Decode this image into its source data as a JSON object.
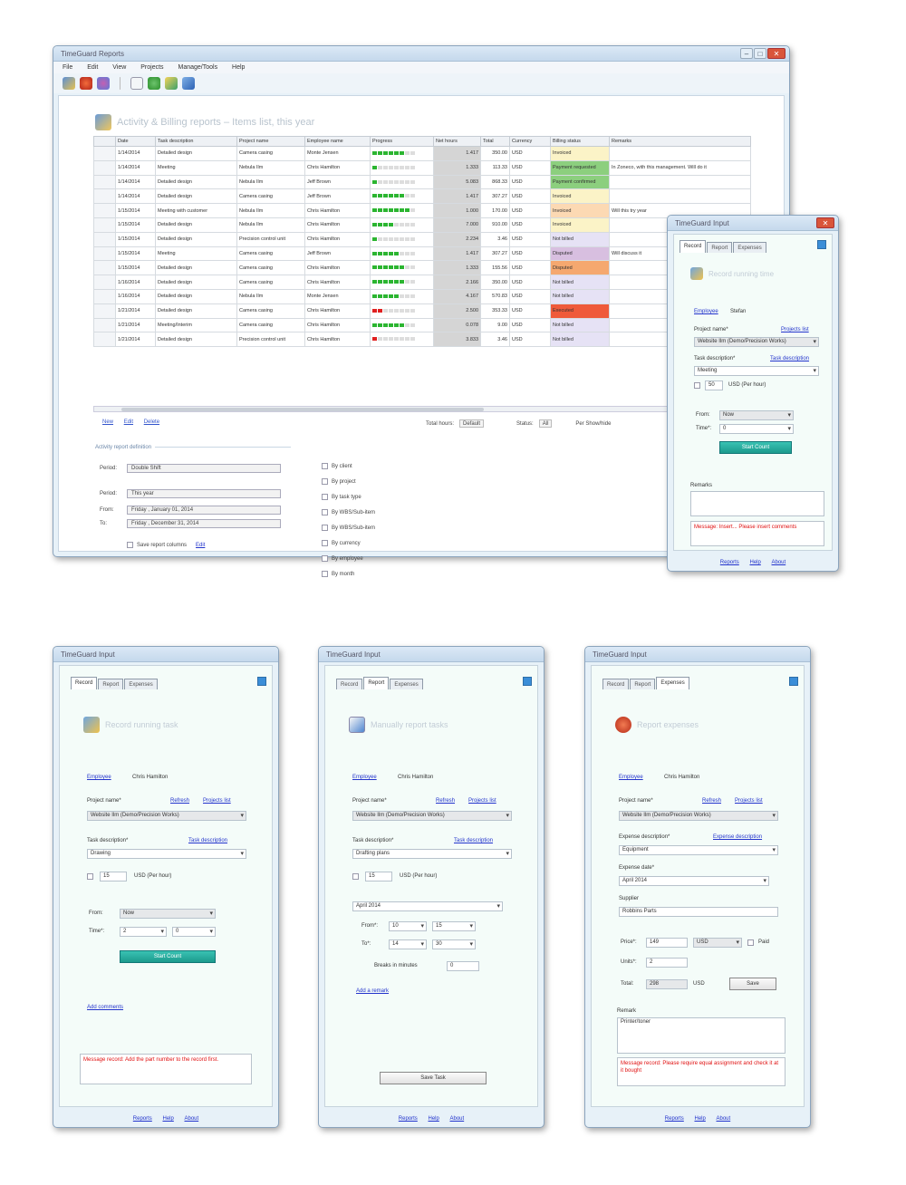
{
  "report_window": {
    "title": "TimeGuard Reports",
    "menu": [
      "File",
      "Edit",
      "View",
      "Projects",
      "Manage/Tools",
      "Help"
    ],
    "report_title": "Activity & Billing reports  –  Items list, this year",
    "columns": [
      "",
      "Date",
      "Task description",
      "Project name",
      "Employee name",
      "Progress",
      "Net hours",
      "Total",
      "Currency",
      "Billing status",
      "Remarks"
    ],
    "rows": [
      {
        "date": "1/14/2014",
        "task": "Detailed design",
        "project": "Camera casing",
        "employee": "Monte Jensen",
        "prog": 6,
        "hours": "1.417",
        "total": "350.00",
        "cur": "USD",
        "status": "Invoiced",
        "status_color": "#fbf3c7",
        "remarks": ""
      },
      {
        "date": "1/14/2014",
        "task": "Meeting",
        "project": "Nebula Ilm",
        "employee": "Chris Hamilton",
        "prog": 1,
        "hours": "1.333",
        "total": "113.33",
        "cur": "USD",
        "status": "Payment requested",
        "status_color": "#8ccf7e",
        "remarks": "In Zoneco, with this management. Will do it"
      },
      {
        "date": "1/14/2014",
        "task": "Detailed design",
        "project": "Nebula Ilm",
        "employee": "Jeff Brown",
        "prog": 1,
        "hours": "5.083",
        "total": "868.33",
        "cur": "USD",
        "status": "Payment confirmed",
        "status_color": "#8ccf7e",
        "remarks": ""
      },
      {
        "date": "1/14/2014",
        "task": "Detailed design",
        "project": "Camera casing",
        "employee": "Jeff Brown",
        "prog": 6,
        "hours": "1.417",
        "total": "307.27",
        "cur": "USD",
        "status": "Invoiced",
        "status_color": "#fbf3c7",
        "remarks": ""
      },
      {
        "date": "1/15/2014",
        "task": "Meeting with customer",
        "project": "Nebula Ilm",
        "employee": "Chris Hamilton",
        "prog": 7,
        "hours": "1.000",
        "total": "170.00",
        "cur": "USD",
        "status": "Invoiced",
        "status_color": "#fcd9b3",
        "remarks": "Will this try year"
      },
      {
        "date": "1/15/2014",
        "task": "Detailed design",
        "project": "Nebula Ilm",
        "employee": "Chris Hamilton",
        "prog": 4,
        "hours": "7.000",
        "total": "910.00",
        "cur": "USD",
        "status": "Invoiced",
        "status_color": "#fbf3c7",
        "remarks": ""
      },
      {
        "date": "1/15/2014",
        "task": "Detailed design",
        "project": "Precision control unit",
        "employee": "Chris Hamilton",
        "prog": 1,
        "hours": "2.234",
        "total": "3.46",
        "cur": "USD",
        "status": "Not billed",
        "status_color": "#e6e2f5",
        "remarks": ""
      },
      {
        "date": "1/15/2014",
        "task": "Meeting",
        "project": "Camera casing",
        "employee": "Jeff Brown",
        "prog": 5,
        "hours": "1.417",
        "total": "307.27",
        "cur": "USD",
        "status": "Disputed",
        "status_color": "#d8bfe0",
        "remarks": "Will discuss it"
      },
      {
        "date": "1/15/2014",
        "task": "Detailed design",
        "project": "Camera casing",
        "employee": "Chris Hamilton",
        "prog": 6,
        "hours": "1.333",
        "total": "155.56",
        "cur": "USD",
        "status": "Disputed",
        "status_color": "#f5a86f",
        "remarks": ""
      },
      {
        "date": "1/16/2014",
        "task": "Detailed design",
        "project": "Camera casing",
        "employee": "Chris Hamilton",
        "prog": 6,
        "hours": "2.166",
        "total": "350.00",
        "cur": "USD",
        "status": "Not billed",
        "status_color": "#e6e2f5",
        "remarks": ""
      },
      {
        "date": "1/16/2014",
        "task": "Detailed design",
        "project": "Nebula Ilm",
        "employee": "Monte Jensen",
        "prog": 5,
        "hours": "4.167",
        "total": "570.83",
        "cur": "USD",
        "status": "Not billed",
        "status_color": "#e6e2f5",
        "remarks": ""
      },
      {
        "date": "1/21/2014",
        "task": "Detailed design",
        "project": "Camera casing",
        "employee": "Chris Hamilton",
        "prog": -2,
        "hours": "2.500",
        "total": "353.33",
        "cur": "USD",
        "status": "Executed",
        "status_color": "#ef5a3a",
        "remarks": ""
      },
      {
        "date": "1/21/2014",
        "task": "Meeting/Interim",
        "project": "Camera casing",
        "employee": "Chris Hamilton",
        "prog": 6,
        "hours": "0.078",
        "total": "9.00",
        "cur": "USD",
        "status": "Not billed",
        "status_color": "#e6e2f5",
        "remarks": ""
      },
      {
        "date": "1/21/2014",
        "task": "Detailed design",
        "project": "Precision control unit",
        "employee": "Chris Hamilton",
        "prog": -1,
        "hours": "3.833",
        "total": "3.46",
        "cur": "USD",
        "status": "Not billed",
        "status_color": "#e6e2f5",
        "remarks": ""
      }
    ],
    "grid_links": [
      "New",
      "Edit",
      "Delete"
    ],
    "totals_label": "Total hours:",
    "totals_value": "Default",
    "status_label": "Status:",
    "status_value": "All",
    "show_cancelled": "Per Show/hide",
    "options_heading": "Activity report definition",
    "period_label": "Period:",
    "period_value": "Double Shift",
    "period2_label": "Period:",
    "period2_value": "This year",
    "from_label": "From:",
    "from_value": "Friday ,   January  01, 2014",
    "to_label": "To:",
    "to_value": "Friday ,   December 31, 2014",
    "save_report": "Save report columns",
    "save_link": "Edit",
    "checks": [
      "By client",
      "By project",
      "By task type",
      "By WBS/Sub-item",
      "By WBS/Sub-item",
      "By currency",
      "By employee",
      "By month"
    ]
  },
  "float_panel": {
    "title": "TimeGuard Input",
    "tabs": [
      "Record",
      "Report",
      "Expenses"
    ],
    "heading": "Record running time",
    "employee_label": "Employee",
    "employee_value": "Stefan",
    "project_label": "Project name*",
    "project_link": "Projects list",
    "project_value": "Website Ilm   (Demo/Precision Works)",
    "task_label": "Task description*",
    "task_link": "Task description",
    "task_value": "Meeting",
    "rate_value": "50",
    "rate_unit": "USD (Per hour)",
    "from_label": "From:",
    "from_value": "Now",
    "time_label": "Time*:",
    "time_value": "0",
    "start_btn": "Start Count",
    "remark_label": "Remarks",
    "msg": "Message: Insert... Please insert comments",
    "footer": [
      "Reports",
      "Help",
      "About"
    ]
  },
  "panels": [
    {
      "title": "TimeGuard Input",
      "tabs": [
        "Record",
        "Report",
        "Expenses"
      ],
      "active_tab": 0,
      "heading": "Record running task",
      "employee_label": "Employee",
      "employee_value": "Chris Hamilton",
      "project_label": "Project name*",
      "link1": "Refresh",
      "link2": "Projects list",
      "project_value": "Website Ilm   (Demo/Precision Works)",
      "task_label": "Task description*",
      "task_link": "Task description",
      "task_value": "Drawing",
      "rate_value": "15",
      "rate_unit": "USD (Per hour)",
      "from_label": "From:",
      "from_value": "Now",
      "time_label": "Time*:",
      "time_hours": "2",
      "time_mins": "0",
      "start_btn": "Start Count",
      "add_link": "Add comments",
      "msg": "Message record:  Add the part number to the record first.",
      "footer": [
        "Reports",
        "Help",
        "About"
      ]
    },
    {
      "title": "TimeGuard Input",
      "tabs": [
        "Record",
        "Report",
        "Expenses"
      ],
      "active_tab": 1,
      "heading": "Manually report tasks",
      "employee_label": "Employee",
      "employee_value": "Chris Hamilton",
      "project_label": "Project name*",
      "link1": "Refresh",
      "link2": "Projects list",
      "project_value": "Website Ilm   (Demo/Precision Works)",
      "task_label": "Task description*",
      "task_link": "Task description",
      "task_value": "Drafting plans",
      "rate_value": "15",
      "rate_unit": "USD (Per hour)",
      "date_value": "April   2014",
      "from_label": "From*:",
      "from_h": "10",
      "from_m": "15",
      "to_label": "To*:",
      "to_h": "14",
      "to_m": "30",
      "break_label": "Breaks in minutes",
      "break_value": "0",
      "add_link": "Add a remark",
      "save_btn": "Save Task",
      "footer": [
        "Reports",
        "Help",
        "About"
      ]
    },
    {
      "title": "TimeGuard Input",
      "tabs": [
        "Record",
        "Report",
        "Expenses"
      ],
      "active_tab": 2,
      "heading": "Report expenses",
      "employee_label": "Employee",
      "employee_value": "Chris Hamilton",
      "project_label": "Project name*",
      "link1": "Refresh",
      "link2": "Projects list",
      "project_value": "Website Ilm   (Demo/Precision Works)",
      "exp_label": "Expense description*",
      "exp_link": "Expense description",
      "exp_value": "Equipment",
      "date_label": "Expense date*",
      "date_value": "April   2014",
      "supplier_label": "Supplier",
      "supplier_value": "Robbins Parts",
      "price_label": "Price*:",
      "price_value": "149",
      "currency_value": "USD",
      "paid_label": "Paid",
      "units_label": "Units*:",
      "units_value": "2",
      "total_label": "Total:",
      "total_value": "298",
      "total_unit": "USD",
      "save_btn": "Save",
      "remark_label": "Remark",
      "remark_value": "Printer/toner",
      "msg": "Message record:  Please require equal assignment and check it at it bought",
      "footer": [
        "Reports",
        "Help",
        "About"
      ]
    }
  ]
}
